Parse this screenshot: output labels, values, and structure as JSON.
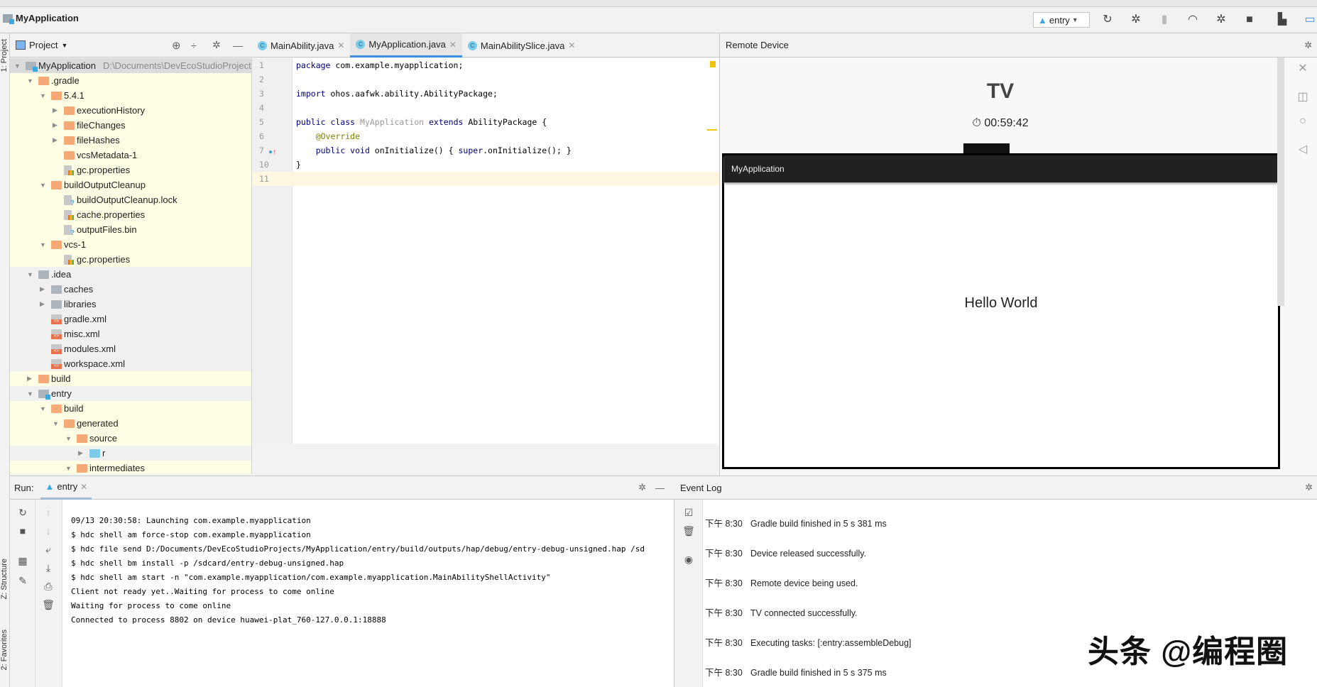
{
  "toolbar": {
    "project": "MyApplication",
    "run_config": "entry",
    "icons": [
      "rerun-icon",
      "debug-icon",
      "attach-debugger-icon",
      "profile-icon",
      "build-icon",
      "stop-icon",
      "project-structure-icon",
      "remote-device-icon"
    ]
  },
  "side_tabs": {
    "project": "1: Project",
    "structure": "Z: Structure",
    "favorites": "2: Favorites"
  },
  "project_panel": {
    "title": "Project",
    "tree": [
      {
        "label": "MyApplication",
        "path": "D:\\Documents\\DevEcoStudioProject",
        "d": 0,
        "a": "open",
        "i": "module",
        "bg": "sel"
      },
      {
        "label": ".gradle",
        "d": 1,
        "a": "open",
        "i": "orange",
        "bg": "yellow"
      },
      {
        "label": "5.4.1",
        "d": 2,
        "a": "open",
        "i": "orange",
        "bg": "yellow"
      },
      {
        "label": "executionHistory",
        "d": 3,
        "a": "closed",
        "i": "orange",
        "bg": "yellow"
      },
      {
        "label": "fileChanges",
        "d": 3,
        "a": "closed",
        "i": "orange",
        "bg": "yellow"
      },
      {
        "label": "fileHashes",
        "d": 3,
        "a": "closed",
        "i": "orange",
        "bg": "yellow"
      },
      {
        "label": "vcsMetadata-1",
        "d": 3,
        "a": "",
        "i": "orange",
        "bg": "yellow"
      },
      {
        "label": "gc.properties",
        "d": 3,
        "a": "",
        "i": "props",
        "bg": "yellow"
      },
      {
        "label": "buildOutputCleanup",
        "d": 2,
        "a": "open",
        "i": "orange",
        "bg": "yellow"
      },
      {
        "label": "buildOutputCleanup.lock",
        "d": 3,
        "a": "",
        "i": "unknown",
        "bg": "yellow"
      },
      {
        "label": "cache.properties",
        "d": 3,
        "a": "",
        "i": "props",
        "bg": "yellow"
      },
      {
        "label": "outputFiles.bin",
        "d": 3,
        "a": "",
        "i": "unknown",
        "bg": "yellow"
      },
      {
        "label": "vcs-1",
        "d": 2,
        "a": "open",
        "i": "orange",
        "bg": "yellow"
      },
      {
        "label": "gc.properties",
        "d": 3,
        "a": "",
        "i": "props",
        "bg": "yellow"
      },
      {
        "label": ".idea",
        "d": 1,
        "a": "open",
        "i": "gray",
        "bg": "gray"
      },
      {
        "label": "caches",
        "d": 2,
        "a": "closed",
        "i": "gray",
        "bg": "gray"
      },
      {
        "label": "libraries",
        "d": 2,
        "a": "closed",
        "i": "gray",
        "bg": "gray"
      },
      {
        "label": "gradle.xml",
        "d": 2,
        "a": "",
        "i": "xml",
        "bg": "gray"
      },
      {
        "label": "misc.xml",
        "d": 2,
        "a": "",
        "i": "xml",
        "bg": "gray"
      },
      {
        "label": "modules.xml",
        "d": 2,
        "a": "",
        "i": "xml",
        "bg": "gray"
      },
      {
        "label": "workspace.xml",
        "d": 2,
        "a": "",
        "i": "xml",
        "bg": "gray"
      },
      {
        "label": "build",
        "d": 1,
        "a": "closed",
        "i": "orange",
        "bg": "yellow"
      },
      {
        "label": "entry",
        "d": 1,
        "a": "open",
        "i": "module",
        "bg": "gray"
      },
      {
        "label": "build",
        "d": 2,
        "a": "open",
        "i": "orange",
        "bg": "yellow"
      },
      {
        "label": "generated",
        "d": 3,
        "a": "open",
        "i": "orange",
        "bg": "yellow"
      },
      {
        "label": "source",
        "d": 4,
        "a": "open",
        "i": "orange",
        "bg": "yellow"
      },
      {
        "label": "r",
        "d": 5,
        "a": "closed",
        "i": "blue",
        "bg": "gray"
      },
      {
        "label": "intermediates",
        "d": 4,
        "a": "open",
        "i": "orange",
        "bg": "yellow"
      }
    ]
  },
  "editor": {
    "tabs": [
      {
        "label": "MainAbility.java",
        "active": false
      },
      {
        "label": "MyApplication.java",
        "active": true
      },
      {
        "label": "MainAbilitySlice.java",
        "active": false
      }
    ],
    "lines": [
      {
        "n": "1",
        "html": "<span class='kw'>package</span> com.example.myapplication;"
      },
      {
        "n": "2",
        "html": ""
      },
      {
        "n": "3",
        "html": "<span class='kw'>import</span> ohos.aafwk.ability.AbilityPackage;"
      },
      {
        "n": "4",
        "html": ""
      },
      {
        "n": "5",
        "html": "<span class='kw'>public class</span> <span class='dim'>MyApplication</span> <span class='kw'>extends</span> AbilityPackage {"
      },
      {
        "n": "6",
        "html": "    <span class='ann'>@Override</span>"
      },
      {
        "n": "7",
        "html": "    <span class='kw'>public void</span> onInitialize() { <span class='kw'>super</span>.onInitialize(); }"
      },
      {
        "n": "10",
        "html": "}"
      },
      {
        "n": "11",
        "html": ""
      }
    ]
  },
  "remote_device": {
    "title": "Remote Device",
    "device": "TV",
    "timer": "00:59:42",
    "app_title": "MyApplication",
    "content": "Hello World"
  },
  "run": {
    "label": "Run:",
    "tab": "entry",
    "lines": [
      "09/13 20:30:58: Launching com.example.myapplication",
      "$ hdc shell am force-stop com.example.myapplication",
      "$ hdc file send D:/Documents/DevEcoStudioProjects/MyApplication/entry/build/outputs/hap/debug/entry-debug-unsigned.hap /sd",
      "$ hdc shell bm install -p /sdcard/entry-debug-unsigned.hap",
      "$ hdc shell am start -n \"com.example.myapplication/com.example.myapplication.MainAbilityShellActivity\"",
      "Client not ready yet..Waiting for process to come online",
      "Waiting for process to come online",
      "Connected to process 8802 on device huawei-plat_760-127.0.0.1:18888"
    ]
  },
  "event_log": {
    "title": "Event Log",
    "events": [
      {
        "time": "下午 8:30",
        "msg": "Gradle build finished in 5 s 381 ms"
      },
      {
        "time": "下午 8:30",
        "msg": "Device released successfully."
      },
      {
        "time": "下午 8:30",
        "msg": "Remote device being used."
      },
      {
        "time": "下午 8:30",
        "msg": "TV connected successfully."
      },
      {
        "time": "下午 8:30",
        "msg": "Executing tasks: [:entry:assembleDebug]"
      },
      {
        "time": "下午 8:30",
        "msg": "Gradle build finished in 5 s 375 ms"
      }
    ]
  },
  "watermark": "头条 @编程圈",
  "colors": {
    "accent": "#3d8fe0",
    "folder": "#f4a977",
    "highlight_yellow": "#fefee5"
  }
}
